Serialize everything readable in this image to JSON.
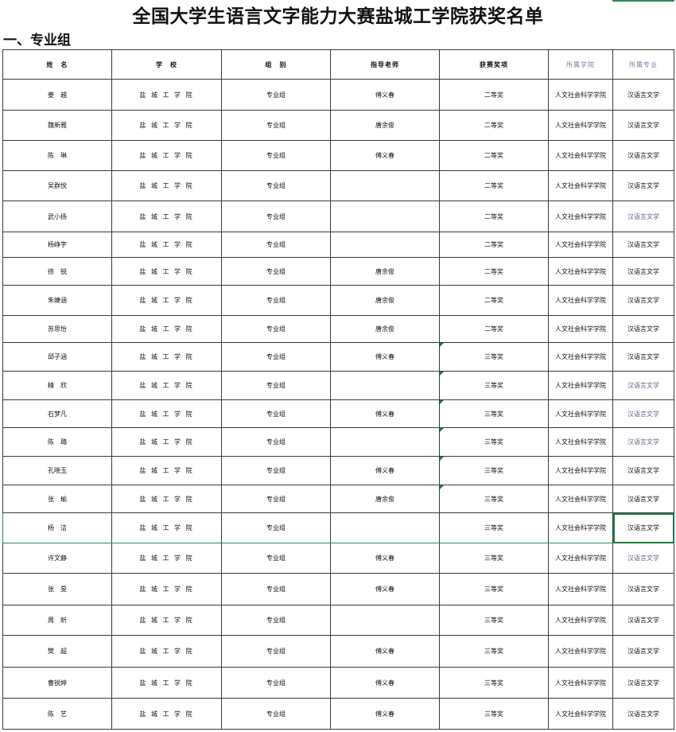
{
  "title": "全国大学生语言文字能力大赛盐城工学院获奖名单",
  "section": "一、专业组",
  "headers": [
    "姓　名",
    "学　校",
    "组　别",
    "指导老师",
    "获赛奖项",
    "所属学院",
    "所属专业"
  ],
  "rows": [
    {
      "name": "姜　越",
      "school": "盐 城 工 学 院",
      "group": "专业组",
      "teacher": "傅义春",
      "award": "二等奖",
      "college": "人文社会科学学院",
      "major": "汉语言文学"
    },
    {
      "name": "魏新雅",
      "school": "盐 城 工 学 院",
      "group": "专业组",
      "teacher": "唐余俊",
      "award": "二等奖",
      "college": "人文社会科学学院",
      "major": "汉语言文学"
    },
    {
      "name": "陈　琳",
      "school": "盐 城 工 学 院",
      "group": "专业组",
      "teacher": "傅义春",
      "award": "二等奖",
      "college": "人文社会科学学院",
      "major": "汉语言文学"
    },
    {
      "name": "吴群悦",
      "school": "盐 城 工 学 院",
      "group": "专业组",
      "teacher": "",
      "award": "二等奖",
      "college": "人文社会科学学院",
      "major": "汉语言文学"
    },
    {
      "name": "武小扬",
      "school": "盐 城 工 学 院",
      "group": "专业组",
      "teacher": "",
      "award": "二等奖",
      "college": "人文社会科学学院",
      "major": "汉语言文学"
    },
    {
      "name": "杨峥宇",
      "school": "盐 城 工 学 院",
      "group": "专业组",
      "teacher": "",
      "award": "二等奖",
      "college": "人文社会科学学院",
      "major": "汉语言文学"
    },
    {
      "name": "徐　锐",
      "school": "盐 城 工 学 院",
      "group": "专业组",
      "teacher": "唐余俊",
      "award": "二等奖",
      "college": "人文社会科学学院",
      "major": "汉语言文学"
    },
    {
      "name": "朱婕涵",
      "school": "盐 城 工 学 院",
      "group": "专业组",
      "teacher": "唐余俊",
      "award": "二等奖",
      "college": "人文社会科学学院",
      "major": "汉语言文学"
    },
    {
      "name": "苏思怡",
      "school": "盐 城 工 学 院",
      "group": "专业组",
      "teacher": "唐余俊",
      "award": "二等奖",
      "college": "人文社会科学学院",
      "major": "汉语言文学"
    },
    {
      "name": "邱子涵",
      "school": "盐 城 工 学 院",
      "group": "专业组",
      "teacher": "傅义春",
      "award": "三等奖",
      "college": "人文社会科学学院",
      "major": "汉语言文学"
    },
    {
      "name": "精　欣",
      "school": "盐 城 工 学 院",
      "group": "专业组",
      "teacher": "",
      "award": "三等奖",
      "college": "人文社会科学学院",
      "major": "汉语言文学"
    },
    {
      "name": "石梦凡",
      "school": "盐 城 工 学 院",
      "group": "专业组",
      "teacher": "傅义春",
      "award": "三等奖",
      "college": "人文社会科学学院",
      "major": "汉语言文学"
    },
    {
      "name": "陈　璐",
      "school": "盐 城 工 学 院",
      "group": "专业组",
      "teacher": "",
      "award": "三等奖",
      "college": "人文社会科学学院",
      "major": "汉语言文学"
    },
    {
      "name": "孔晓玉",
      "school": "盐 城 工 学 院",
      "group": "专业组",
      "teacher": "傅义春",
      "award": "三等奖",
      "college": "人文社会科学学院",
      "major": "汉语言文学"
    },
    {
      "name": "张　瑜",
      "school": "盐 城 工 学 院",
      "group": "专业组",
      "teacher": "唐余俊",
      "award": "三等奖",
      "college": "人文社会科学学院",
      "major": "汉语言文学"
    },
    {
      "name": "杨　洁",
      "school": "盐 城 工 学 院",
      "group": "专业组",
      "teacher": "",
      "award": "三等奖",
      "college": "人文社会科学学院",
      "major": "汉语言文学"
    },
    {
      "name": "许文静",
      "school": "盐 城 工 学 院",
      "group": "专业组",
      "teacher": "傅义春",
      "award": "三等奖",
      "college": "人文社会科学学院",
      "major": "汉语言文学"
    },
    {
      "name": "张　旻",
      "school": "盐 城 工 学 院",
      "group": "专业组",
      "teacher": "傅义春",
      "award": "三等奖",
      "college": "人文社会科学学院",
      "major": "汉语言文学"
    },
    {
      "name": "周　昕",
      "school": "盐 城 工 学 院",
      "group": "专业组",
      "teacher": "",
      "award": "三等奖",
      "college": "人文社会科学学院",
      "major": "汉语言文学"
    },
    {
      "name": "樊　超",
      "school": "盐 城 工 学 院",
      "group": "专业组",
      "teacher": "傅义春",
      "award": "三等奖",
      "college": "人文社会科学学院",
      "major": "汉语言文学"
    },
    {
      "name": "曹锐婷",
      "school": "盐 城 工 学 院",
      "group": "专业组",
      "teacher": "傅义春",
      "award": "三等奖",
      "college": "人文社会科学学院",
      "major": "汉语言文学"
    },
    {
      "name": "陈　艺",
      "school": "盐 城 工 学 院",
      "group": "专业组",
      "teacher": "傅义春",
      "award": "三等奖",
      "college": "人文社会科学学院",
      "major": "汉语言文学"
    }
  ]
}
